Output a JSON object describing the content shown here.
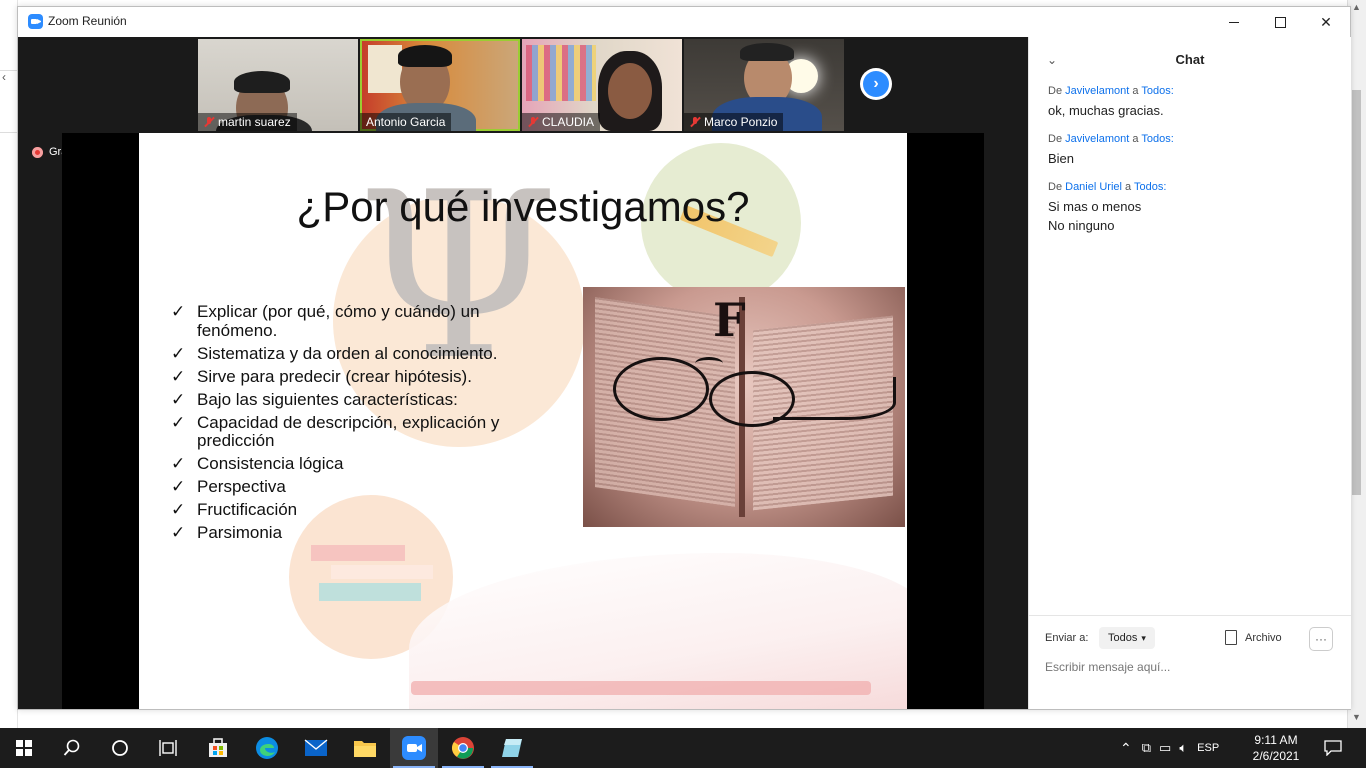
{
  "window": {
    "title": "Zoom Reunión"
  },
  "participants": [
    {
      "name": "martin suarez",
      "muted": true
    },
    {
      "name": "Antonio Garcia",
      "muted": false,
      "active_speaker": true
    },
    {
      "name": "CLAUDIA",
      "muted": true
    },
    {
      "name": "Marco Ponzio",
      "muted": true
    }
  ],
  "recording": {
    "label": "Grabando"
  },
  "slide": {
    "title": "¿Por qué investigamos?",
    "bullets": [
      "Explicar (por qué, cómo y cuándo) un fenómeno.",
      "Sistematiza y da orden al conocimiento.",
      "Sirve para predecir (crear hipótesis).",
      "Bajo las siguientes características:",
      "Capacidad de descripción, explicación y predicción",
      "Consistencia lógica",
      "Perspectiva",
      "Fructificación",
      "Parsimonia"
    ],
    "image_letter": "F"
  },
  "chat": {
    "title": "Chat",
    "messages": [
      {
        "prefix": "De",
        "from": "Javivelamont",
        "conj": "a",
        "to": "Todos:",
        "lines": [
          "ok, muchas gracias."
        ]
      },
      {
        "prefix": "De",
        "from": "Javivelamont",
        "conj": "a",
        "to": "Todos:",
        "lines": [
          "Bien"
        ]
      },
      {
        "prefix": "De",
        "from": "Daniel Uriel",
        "conj": "a",
        "to": "Todos:",
        "lines": [
          "Si mas o menos",
          "No ninguno"
        ]
      }
    ],
    "send_to_label": "Enviar a:",
    "send_to_value": "Todos",
    "file_label": "Archivo",
    "more_label": "···",
    "input_placeholder": "Escribir mensaje aquí..."
  },
  "taskbar": {
    "language": "ESP",
    "time": "9:11 AM",
    "date": "2/6/2021"
  },
  "colors": {
    "zoom_blue": "#2d8cff",
    "link_blue": "#0e71eb",
    "muted_red": "#e53935",
    "active_speaker": "#9acd32"
  }
}
